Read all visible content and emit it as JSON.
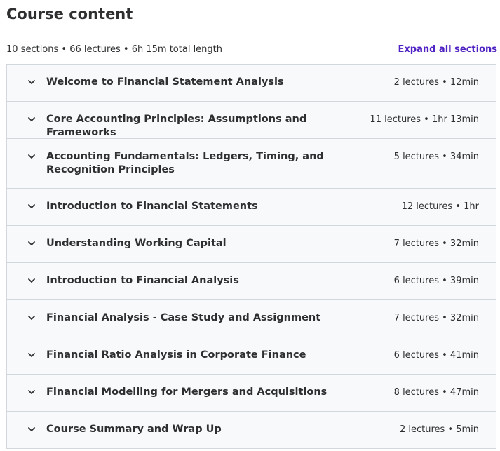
{
  "header": {
    "title": "Course content",
    "meta": "10 sections • 66 lectures • 6h 15m total length",
    "expand_label": "Expand all sections"
  },
  "sections": [
    {
      "title": "Welcome to Financial Statement Analysis",
      "info": "2 lectures • 12min"
    },
    {
      "title": "Core Accounting Principles: Assumptions and Frameworks",
      "info": "11 lectures • 1hr 13min"
    },
    {
      "title": "Accounting Fundamentals: Ledgers, Timing, and Recognition Principles",
      "info": "5 lectures • 34min"
    },
    {
      "title": "Introduction to Financial Statements",
      "info": "12 lectures • 1hr"
    },
    {
      "title": "Understanding Working Capital",
      "info": "7 lectures • 32min"
    },
    {
      "title": "Introduction to Financial Analysis",
      "info": "6 lectures • 39min"
    },
    {
      "title": "Financial Analysis - Case Study and Assignment",
      "info": "7 lectures • 32min"
    },
    {
      "title": "Financial Ratio Analysis in Corporate Finance",
      "info": "6 lectures • 41min"
    },
    {
      "title": "Financial Modelling for Mergers and Acquisitions",
      "info": "8 lectures • 47min"
    },
    {
      "title": "Course Summary and Wrap Up",
      "info": "2 lectures • 5min"
    }
  ],
  "icons": {
    "chevron": "chevron-down-icon"
  },
  "colors": {
    "accent": "#5022c3",
    "section_bg": "#f7f9fa",
    "border": "#d1d7dc",
    "text": "#2d2f31"
  }
}
